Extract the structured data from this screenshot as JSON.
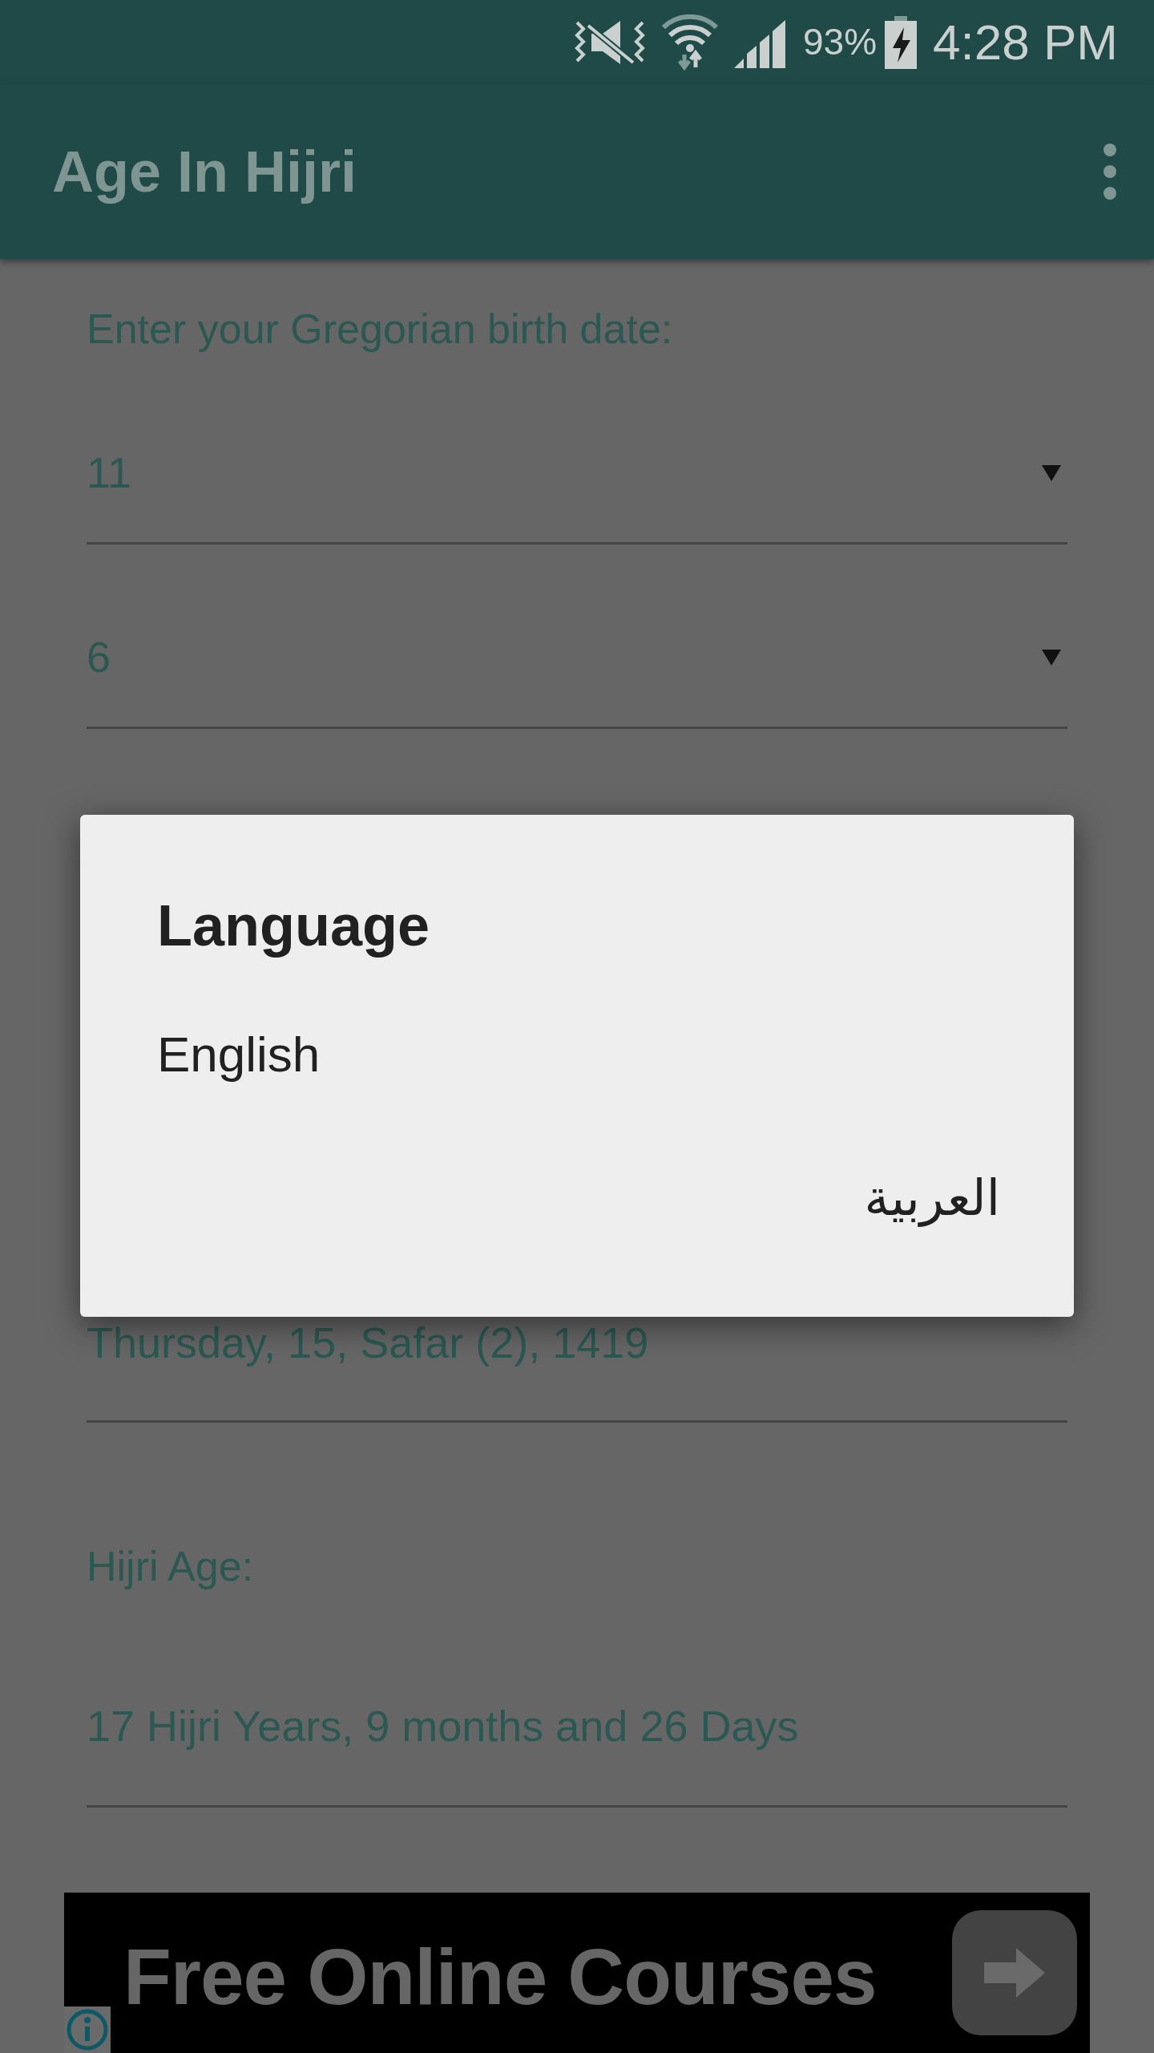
{
  "status_bar": {
    "battery": "93%",
    "time": "4:28 PM"
  },
  "app_bar": {
    "title": "Age In Hijri"
  },
  "form": {
    "prompt": "Enter your Gregorian birth date:",
    "spinners": [
      "11",
      "6"
    ],
    "hijri_date": "Thursday, 15, Safar (2), 1419",
    "age_label": "Hijri Age:",
    "age_value": "17 Hijri Years, 9 months and 26 Days"
  },
  "dialog": {
    "title": "Language",
    "options": [
      {
        "label": "English",
        "kind": "start"
      },
      {
        "label": "العربية",
        "kind": "end"
      }
    ]
  },
  "ad": {
    "text": "Free Online Courses"
  }
}
